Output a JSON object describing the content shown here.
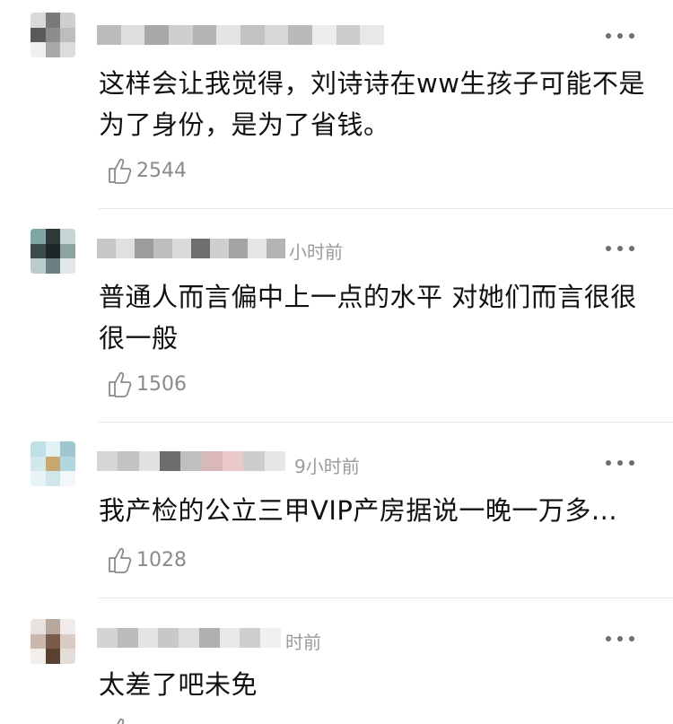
{
  "comments": [
    {
      "text": "这样会让我觉得，刘诗诗在ww生孩子可能不是为了身份，是为了省钱。",
      "time": "",
      "likes": "2544",
      "avatar_colors": [
        "#d9d9d9",
        "#7a7a7a",
        "#cfcfcf",
        "#5a5a5a",
        "#8d8d8d",
        "#bdbdbd",
        "#efefef",
        "#a8a8a8",
        "#dcdcdc"
      ],
      "name_colors": [
        "#bcbcbc",
        "#dedede",
        "#a9a9a9",
        "#cfcfcf",
        "#b5b5b5",
        "#e4e4e4",
        "#c2c2c2",
        "#d8d8d8",
        "#bababa",
        "#ededed",
        "#cccccc",
        "#e8e8e8"
      ]
    },
    {
      "text": "普通人而言偏中上一点的水平  对她们而言很很很一般",
      "time": "小时前",
      "likes": "1506",
      "avatar_colors": [
        "#7fa6a6",
        "#2e3a3a",
        "#c7d4d4",
        "#3b4a4a",
        "#1e2727",
        "#8da3a3",
        "#bccccc",
        "#6b8181",
        "#dfe7e7"
      ],
      "name_colors": [
        "#c6c6c6",
        "#e0e0e0",
        "#9c9c9c",
        "#bdbdbd",
        "#dadada",
        "#6f6f6f",
        "#cfcfcf",
        "#a4a4a4",
        "#e6e6e6",
        "#b3b3b3"
      ]
    },
    {
      "text": "我产检的公立三甲VIP产房据说一晚一万多...",
      "time": "9小时前",
      "likes": "1028",
      "avatar_colors": [
        "#bfe0e6",
        "#e4f1f3",
        "#9fc7cf",
        "#d2e8ec",
        "#c8a66e",
        "#b3d7de",
        "#e8f3f5",
        "#cfe6ea",
        "#f2f8f9"
      ],
      "name_colors": [
        "#d5d5d5",
        "#c3c3c3",
        "#e2e2e2",
        "#6d6d6d",
        "#bfbfbf",
        "#d8b8b8",
        "#ebc9c9",
        "#cdcdcd",
        "#e7e7e7"
      ]
    },
    {
      "text": "太差了吧未免",
      "time": "时前",
      "likes": "",
      "avatar_colors": [
        "#e8e2de",
        "#b8a89c",
        "#f0ebe8",
        "#c9b8ab",
        "#7a5a48",
        "#d8ccc4",
        "#f2eeea",
        "#5a4030",
        "#e4dcd6"
      ],
      "name_colors": [
        "#d4d4d4",
        "#bcbcbc",
        "#e3e3e3",
        "#c8c8c8",
        "#dedede",
        "#b0b0b0",
        "#e9e9e9",
        "#cfcfcf",
        "#f0f0f0"
      ]
    }
  ]
}
